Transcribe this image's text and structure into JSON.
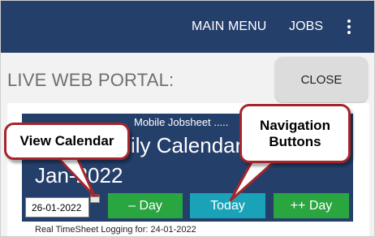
{
  "appbar": {
    "main_menu": "MAIN MENU",
    "jobs": "JOBS",
    "overflow_icon": "kebab-menu-icon",
    "background_color": "#253f6b"
  },
  "portal": {
    "title": "LIVE WEB PORTAL:",
    "close_label": "CLOSE"
  },
  "panel": {
    "subtitle": "Mobile Jobsheet .....",
    "title": "ily Calendar:",
    "month": "Jan-2022",
    "date_value": "26-01-2022",
    "calendar_icon": "calendar-icon",
    "buttons": {
      "prev_day": "– Day",
      "today": "Today",
      "next_day": "++ Day"
    },
    "footer": "Real TimeSheet Logging for: 24-01-2022",
    "colors": {
      "panel": "#253f6b",
      "day_button": "#2aa640",
      "today_button": "#1aa3b8"
    }
  },
  "callouts": {
    "view_calendar": "View Calendar",
    "navigation_buttons": "Navigation Buttons",
    "border_color": "#a4262c"
  }
}
